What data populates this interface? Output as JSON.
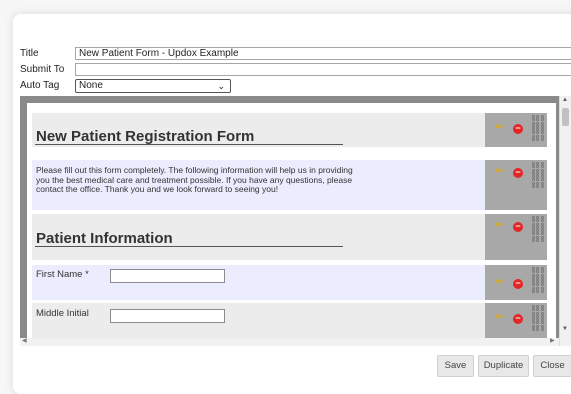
{
  "meta": {
    "title_label": "Title",
    "title_value": "New Patient Form - Updox Example",
    "submit_label": "Submit To",
    "submit_value": "",
    "autotag_label": "Auto Tag",
    "autotag_value": "None"
  },
  "form": {
    "heading": "New Patient Registration Form",
    "intro": "Please fill out this form completely. The following information will help us in providing you the best medical care and treatment possible. If you have any questions, please contact the office. Thank you and we look forward to seeing you!",
    "section_heading": "Patient Information",
    "field_first_name": "First Name *",
    "field_middle_initial": "Middle Initial"
  },
  "icons": {
    "edit": "pencil-icon",
    "delete": "minus-circle-icon",
    "drag": "grip-icon"
  },
  "buttons": {
    "save": "Save",
    "duplicate": "Duplicate",
    "close": "Close"
  },
  "colors": {
    "toolbar": "#a8a8a8",
    "delete": "#e42626",
    "edit": "#e0a800",
    "section_lavender": "#ececff",
    "section_gray": "#ececec"
  }
}
